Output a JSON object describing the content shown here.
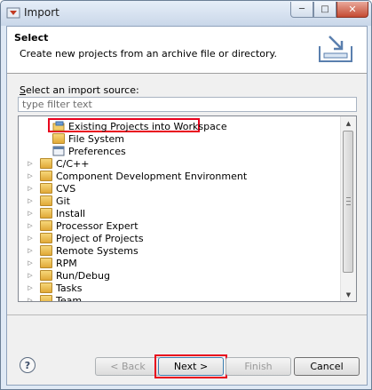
{
  "window": {
    "title": "Import"
  },
  "banner": {
    "title": "Select",
    "description": "Create new projects from an archive file or directory."
  },
  "source": {
    "label_underline": "S",
    "label_rest": "elect an import source:",
    "filter_placeholder": "type filter text"
  },
  "tree": {
    "general_children": [
      {
        "label": "Existing Projects into Workspace",
        "icon": "projects-icon",
        "highlighted": true
      },
      {
        "label": "File System",
        "icon": "folder-icon"
      },
      {
        "label": "Preferences",
        "icon": "preferences-icon"
      }
    ],
    "categories": [
      "C/C++",
      "Component Development Environment",
      "CVS",
      "Git",
      "Install",
      "Processor Expert",
      "Project of Projects",
      "Remote Systems",
      "RPM",
      "Run/Debug",
      "Tasks",
      "Team"
    ]
  },
  "buttons": {
    "help": "?",
    "back": "< Back",
    "next": "Next >",
    "finish": "Finish",
    "cancel": "Cancel"
  },
  "colors": {
    "highlight": "#e8001c",
    "folder": "#e1a937"
  }
}
